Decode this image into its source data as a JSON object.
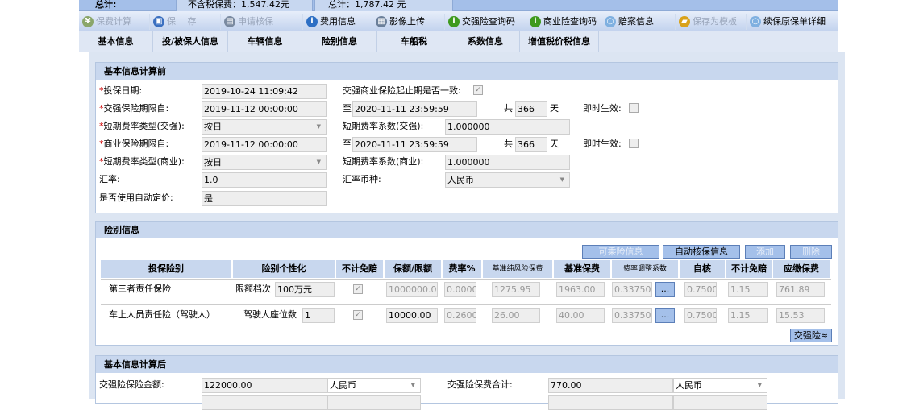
{
  "summary": {
    "total_label": "总计:",
    "pretax": "不含税保费：1,547.42元",
    "total": "总计：1,787.42 元"
  },
  "toolbar": [
    {
      "label": "保费计算",
      "icon": "yen-icon",
      "disabled": true
    },
    {
      "label": "保　 存",
      "icon": "save-icon",
      "disabled": true
    },
    {
      "label": "申请核保",
      "icon": "submit-icon",
      "disabled": true
    },
    {
      "label": "费用信息",
      "icon": "info-icon",
      "disabled": false
    },
    {
      "label": "影像上传",
      "icon": "image-icon",
      "disabled": false
    },
    {
      "label": "交强险查询码",
      "icon": "info-green-icon",
      "disabled": false
    },
    {
      "label": "商业险查询码",
      "icon": "info-green-icon",
      "disabled": false
    },
    {
      "label": "赔案信息",
      "icon": "search-icon",
      "disabled": false
    },
    {
      "label": "保存为模板",
      "icon": "template-icon",
      "disabled": true
    },
    {
      "label": "续保原保单详细",
      "icon": "search-icon",
      "disabled": false
    }
  ],
  "tabs": [
    "基本信息",
    "投/被保人信息",
    "车辆信息",
    "险别信息",
    "车船税",
    "系数信息",
    "增值税价税信息"
  ],
  "before": {
    "title": "基本信息计算前",
    "apply_date_label": "投保日期:",
    "apply_date": "2019-10-24 11:09:42",
    "consistent_label": "交强商业保险起止期是否一致:",
    "ci_start_label": "交强保险期限自:",
    "ci_start": "2019-11-12 00:00:00",
    "to": "至",
    "ci_end": "2020-11-11 23:59:59",
    "total_label": "共",
    "ci_days": "366",
    "days_unit": "天",
    "immediate_label": "即时生效:",
    "ci_short_type_label": "短期费率类型(交强):",
    "ci_short_type": "按日",
    "ci_short_coef_label": "短期费率系数(交强):",
    "ci_short_coef": "1.000000",
    "bi_start_label": "商业保险期限自:",
    "bi_start": "2019-11-12 00:00:00",
    "bi_end": "2020-11-11 23:59:59",
    "bi_days": "366",
    "bi_short_type_label": "短期费率类型(商业):",
    "bi_short_type": "按日",
    "bi_short_coef_label": "短期费率系数(商业):",
    "bi_short_coef": "1.000000",
    "rate_label": "汇率:",
    "rate": "1.0",
    "currency_label": "汇率币种:",
    "currency": "人民币",
    "auto_price_label": "是否使用自动定价:",
    "auto_price": "是"
  },
  "coverage": {
    "title": "险别信息",
    "buttons": [
      "可乘险信息",
      "自动核保信息",
      "添加",
      "删除"
    ],
    "headers": [
      "投保险别",
      "险别个性化",
      "不计免赔",
      "保额/限额",
      "费率%",
      "基准纯风险保费",
      "基准保费",
      "费率调整系数",
      "自核",
      "不计免赔",
      "应缴保费"
    ],
    "rows": [
      {
        "name": "第三者责任保险",
        "custom_label": "限额档次",
        "custom_value": "100万元",
        "amount": "1000000.00",
        "rate": "0.0000",
        "pure": "1275.95",
        "base": "1963.00",
        "adj": "0.337500",
        "self": "0.75000",
        "nd": "1.15",
        "due": "761.89"
      },
      {
        "name": "车上人员责任险（驾驶人）",
        "custom_label": "驾驶人座位数",
        "custom_value": "1",
        "amount": "10000.00",
        "rate": "0.2600",
        "pure": "26.00",
        "base": "40.00",
        "adj": "0.337500",
        "self": "0.75000",
        "nd": "1.15",
        "due": "15.53"
      }
    ],
    "more": "...",
    "ci_toggle": "交强险≈"
  },
  "after": {
    "title": "基本信息计算后",
    "ci_amount_label": "交强险保险金额:",
    "ci_amount": "122000.00",
    "ci_amount_cur": "人民币",
    "ci_premium_label": "交强险保费合计:",
    "ci_premium": "770.00",
    "ci_premium_cur": "人民币"
  }
}
